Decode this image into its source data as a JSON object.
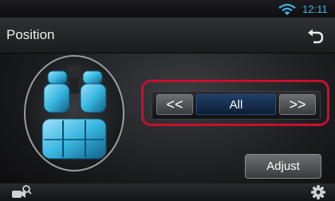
{
  "status": {
    "time": "12:11",
    "wifi_icon": "wifi-icon"
  },
  "header": {
    "title": "Position",
    "back_icon": "back-arrow-icon"
  },
  "seat_diagram": {
    "icon": "car-seats-icon"
  },
  "position_selector": {
    "left_label": "<<",
    "value": "All",
    "right_label": ">>"
  },
  "adjust_label": "Adjust",
  "bottom": {
    "left_icon": "camera-view-icon",
    "right_icon": "settings-gear-icon"
  },
  "colors": {
    "accent": "#3ab6e8",
    "highlight": "#c8102e",
    "seat": "#39b7e0"
  }
}
